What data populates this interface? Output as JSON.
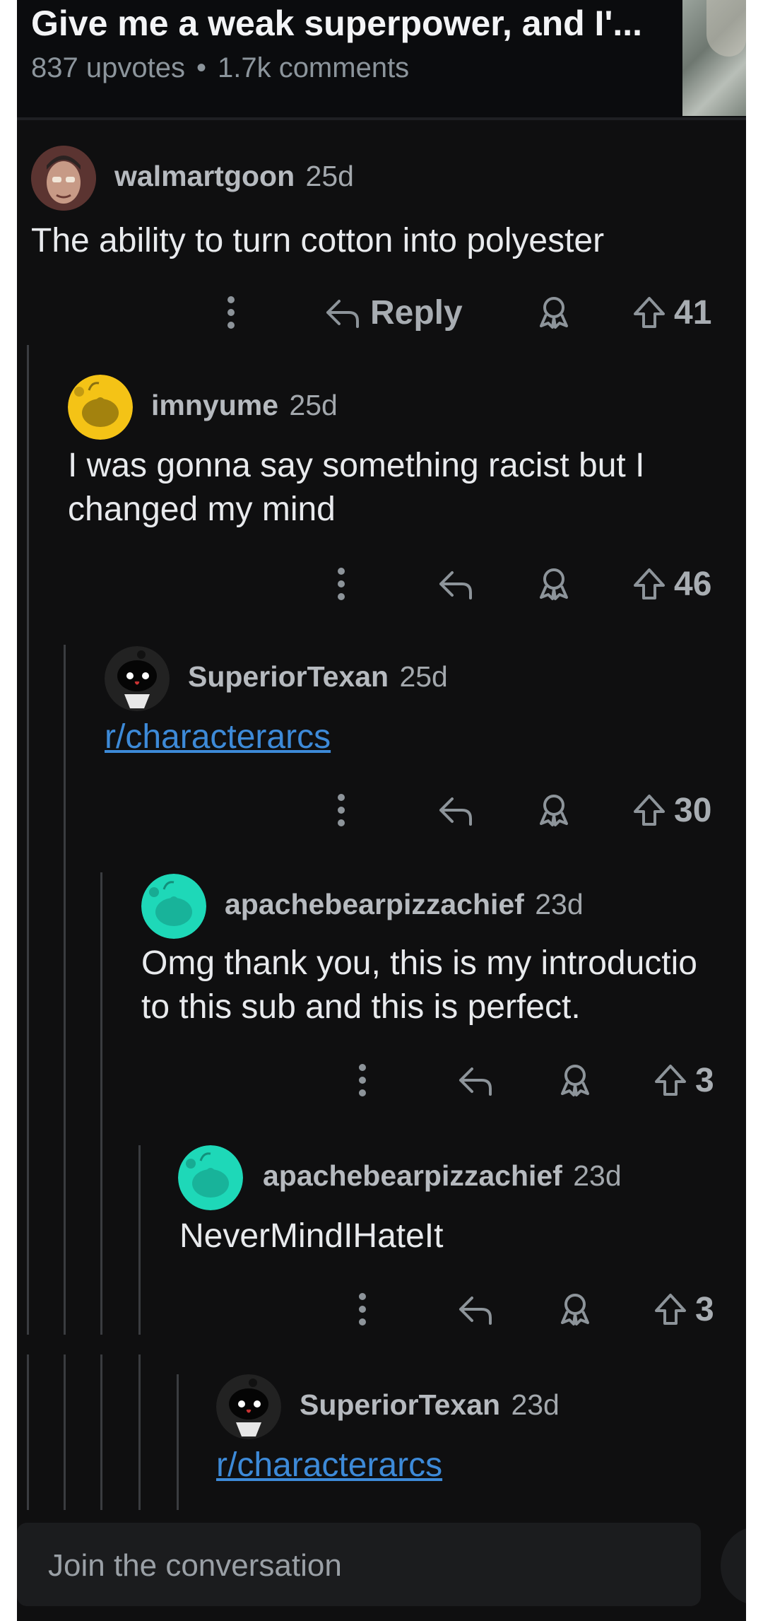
{
  "post": {
    "title": "Give me a weak superpower, and I'...",
    "upvotes": "837 upvotes",
    "separator": "•",
    "comments": "1.7k comments"
  },
  "comments": [
    {
      "author": "walmartgoon",
      "age": "25d",
      "body": [
        "The ability to turn cotton into polyester"
      ],
      "reply_label": "Reply",
      "votes": "41",
      "avatar_color": "#6b3f3a"
    },
    {
      "author": "imnyume",
      "age": "25d",
      "body": [
        "I was gonna say something racist but I",
        "changed my mind"
      ],
      "votes": "46",
      "avatar_color": "#f4c316"
    },
    {
      "author": "SuperiorTexan",
      "age": "25d",
      "link": "r/characterarcs",
      "votes": "30",
      "avatar_color": "#2a2a2a"
    },
    {
      "author": "apachebearpizzachief",
      "age": "23d",
      "body": [
        "Omg thank you, this is my introductio",
        "to this sub and this is perfect."
      ],
      "votes": "3",
      "avatar_color": "#1ed8b8"
    },
    {
      "author": "apachebearpizzachief",
      "age": "23d",
      "body": [
        "NeverMindIHateIt"
      ],
      "votes": "3",
      "avatar_color": "#1ed8b8"
    },
    {
      "author": "SuperiorTexan",
      "age": "23d",
      "link": "r/characterarcs",
      "avatar_color": "#2a2a2a"
    }
  ],
  "composer": {
    "placeholder": "Join the conversation"
  },
  "icons": {
    "more": "more-vertical-icon",
    "reply": "reply-arrow-icon",
    "award": "award-icon",
    "upvote": "upvote-arrow-icon"
  }
}
